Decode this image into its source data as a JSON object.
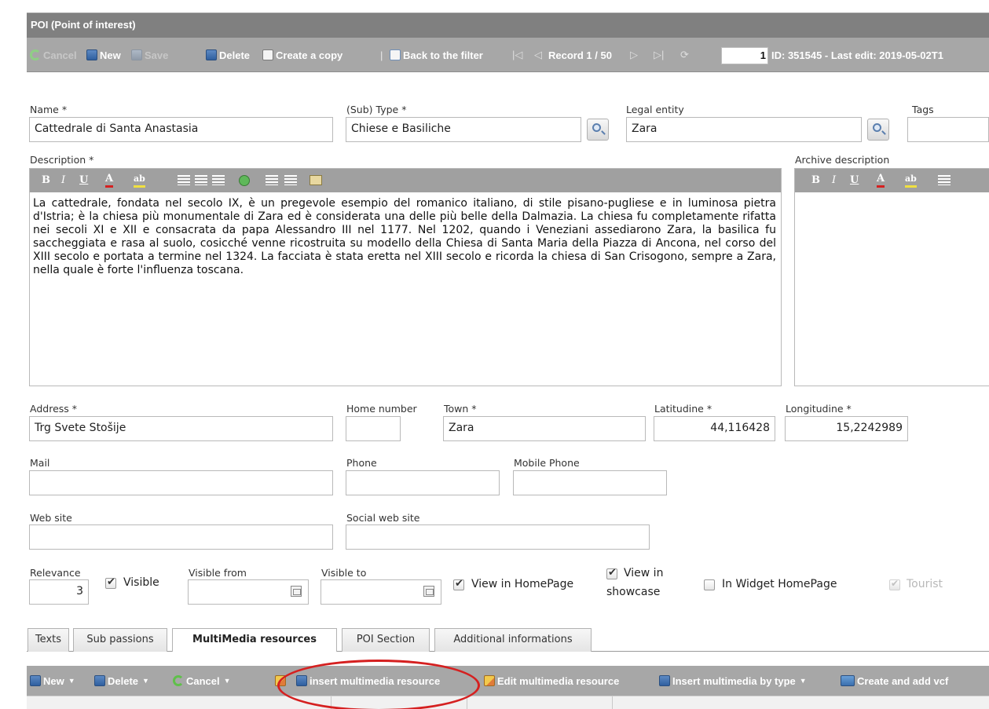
{
  "window": {
    "title": "POI (Point of interest)"
  },
  "toolbar": {
    "cancel": "Cancel",
    "new": "New",
    "save": "Save",
    "delete": "Delete",
    "create_copy": "Create a copy",
    "separator": "|",
    "back_to_filter": "Back to the filter",
    "record_label": "Record 1 / 50",
    "record_number": "1",
    "info": "ID: 351545 - Last edit: 2019-05-02T1"
  },
  "form": {
    "name": {
      "label": "Name *",
      "value": "Cattedrale di Santa Anastasia"
    },
    "subtype": {
      "label": "(Sub) Type *",
      "value": "Chiese e Basiliche"
    },
    "legal_entity": {
      "label": "Legal entity",
      "value": "Zara"
    },
    "tags": {
      "label": "Tags",
      "value": ""
    },
    "description": {
      "label": "Description *",
      "text": "La cattedrale, fondata nel secolo IX, è un pregevole esempio del romanico italiano, di stile pisano-pugliese e in luminosa pietra d'Istria; è la chiesa più monumentale di Zara ed è considerata una delle più belle della Dalmazia. La chiesa fu completamente rifatta nei secoli XI e XII e consacrata da papa Alessandro III nel 1177. Nel 1202, quando i Veneziani assediarono Zara, la basilica fu saccheggiata e rasa al suolo, cosicché venne ricostruita su modello della Chiesa di Santa Maria della Piazza di Ancona, nel corso del XIII secolo e portata a termine nel 1324. La facciata è stata eretta nel XIII secolo e ricorda la chiesa di San Crisogono, sempre a Zara, nella quale è forte l'influenza toscana."
    },
    "archive_description": {
      "label": "Archive description",
      "text": ""
    },
    "editor_buttons": {
      "bold": "B",
      "italic": "I",
      "underline": "U",
      "font_color": "A",
      "highlight": "ab"
    },
    "address": {
      "label": "Address *",
      "value": "Trg Svete Stošije"
    },
    "home_number": {
      "label": "Home number",
      "value": ""
    },
    "town": {
      "label": "Town *",
      "value": "Zara"
    },
    "latitude": {
      "label": "Latitudine *",
      "value": "44,116428"
    },
    "longitude": {
      "label": "Longitudine *",
      "value": "15,2242989"
    },
    "mail": {
      "label": "Mail",
      "value": ""
    },
    "phone": {
      "label": "Phone",
      "value": ""
    },
    "mobile_phone": {
      "label": "Mobile Phone",
      "value": ""
    },
    "web_site": {
      "label": "Web site",
      "value": ""
    },
    "social_web_site": {
      "label": "Social web site",
      "value": ""
    },
    "relevance": {
      "label": "Relevance",
      "value": "3"
    },
    "visible": {
      "label": "Visible",
      "checked": true
    },
    "visible_from": {
      "label": "Visible from",
      "value": ""
    },
    "visible_to": {
      "label": "Visible to",
      "value": ""
    },
    "view_in_homepage": {
      "label": "View in HomePage",
      "checked": true
    },
    "view_in_showcase": {
      "label_line1": "View in",
      "label_line2": "showcase",
      "checked": true
    },
    "in_widget_homepage": {
      "label": "In Widget HomePage",
      "checked": false
    },
    "tourist": {
      "label": "Tourist",
      "checked": true,
      "disabled": true
    }
  },
  "tabs": [
    {
      "label": "Texts",
      "active": false
    },
    {
      "label": "Sub passions",
      "active": false
    },
    {
      "label": "MultiMedia resources",
      "active": true
    },
    {
      "label": "POI Section",
      "active": false
    },
    {
      "label": "Additional informations",
      "active": false
    }
  ],
  "multimedia_toolbar": {
    "new": "New",
    "delete": "Delete",
    "cancel": "Cancel",
    "insert": "insert multimedia resource",
    "edit": "Edit multimedia resource",
    "insert_by_type": "Insert multimedia by type",
    "create_vcf": "Create and add vcf"
  },
  "colors": {
    "header": "#808080",
    "toolbar": "#a7a7a7",
    "highlight_ring": "#d52020"
  }
}
